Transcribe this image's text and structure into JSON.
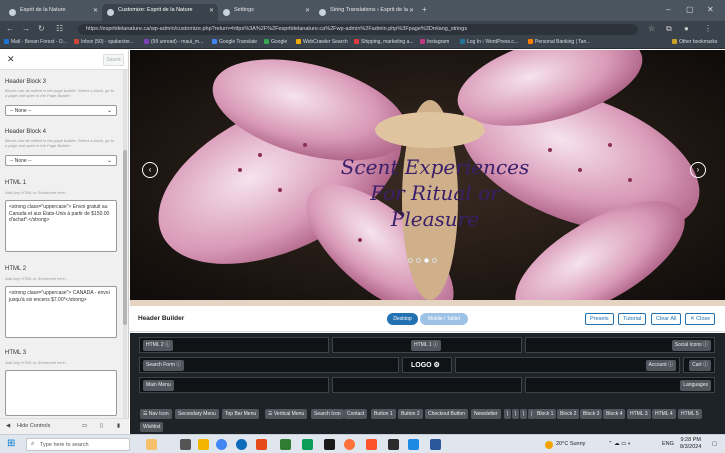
{
  "browser": {
    "tabs": [
      {
        "label": "Esprit de la Nature"
      },
      {
        "label": "Customize: Esprit de la Nature"
      },
      {
        "label": "Settings"
      },
      {
        "label": "String Translations ‹ Esprit de la"
      }
    ],
    "url": "https://espritdelanature.ca/wp-admin/customize.php?return=https%3A%2F%2Fespritdelanature.ca%2Fwp-admin%2Fadmin.php%3Fpage%3Dmlang_strings",
    "bookmarks": [
      "Mail - Bevan Forest - O...",
      "Inbox (50) - spabecter...",
      "(99 unread) - maui_m...",
      "Google Translate",
      "Google",
      "WebCrawler Search",
      "Shipping, marketing a...",
      "Instagram",
      "Log In ‹ WordPress.c...",
      "Personal Banking | Tan..."
    ],
    "other_bookmarks": "Other bookmarks"
  },
  "sidebar": {
    "saved_label": "Saved",
    "sections": [
      {
        "title": "Header Block 3",
        "hint": "Blocks can be edited in the page builder. Select a block, go to a page and open in the Page Builder.",
        "value": "-- None --"
      },
      {
        "title": "Header Block 4",
        "hint": "Blocks can be edited in the page builder. Select a block, go to a page and open in the Page Builder.",
        "value": "-- None --"
      },
      {
        "title": "HTML 1",
        "hint": "Add Any HTML or Shortcode here...",
        "value": "<strong class=\"uppercase\"> Envoi gratuit au Canada et aux États-Unis à partir de $150.00 d'achat*.</strong>"
      },
      {
        "title": "HTML 2",
        "hint": "Add Any HTML or Shortcode here...",
        "value": "<strong class=\"uppercase\"> CANADA - envoi jusqu'à six encens $7.00*</strong>"
      },
      {
        "title": "HTML 3",
        "hint": "Add Any HTML or Shortcode here...",
        "value": ""
      }
    ],
    "footer": {
      "hide_controls": "Hide Controls"
    }
  },
  "preview": {
    "headline_lines": [
      "Scent Experiences",
      "For Ritual or",
      "Pleasure"
    ],
    "slide_count": 4,
    "active_slide": 3
  },
  "header_builder": {
    "title": "Header Builder",
    "modes": {
      "desktop": "Desktop",
      "mobile": "Mobile / Tablet"
    },
    "buttons": {
      "presets": "Presets",
      "tutorial": "Tutorial",
      "clear_all": "Clear All",
      "close": "✕ Close"
    },
    "row1": {
      "left": "HTML 2 ⓘ",
      "center": "HTML 1 ⓘ",
      "right": "Social Icons ⓘ"
    },
    "row2": {
      "left": "Search Form ⓘ",
      "logo": "LOGO ⚙",
      "right1": "Account ⓘ",
      "right2": "Cart ⓘ"
    },
    "row3": {
      "left": "Main Menu",
      "right": "Languages"
    },
    "available": [
      "☰ Nav Icon",
      "Secondary Menu",
      "Top Bar Menu",
      "☰ Vertical Menu",
      "Search Icon",
      "Contact",
      "Button 1",
      "Button 2",
      "Checkout Button",
      "Newsletter",
      "|",
      "|",
      "|",
      "|",
      "Block 1",
      "Block 2",
      "Block 3",
      "Block 4",
      "HTML 3",
      "HTML 4",
      "HTML 5",
      "Wishlist"
    ]
  },
  "taskbar": {
    "search_placeholder": "Type here to search",
    "weather": "20°C  Sunny",
    "lang": "ENG",
    "time": "9:28 PM",
    "date": "8/3/2024"
  },
  "colors": {
    "accent": "#2271b1",
    "desktop_btn": "#2271b1",
    "mobile_btn": "#9ec2e6",
    "headline": "#3a1f6a"
  }
}
